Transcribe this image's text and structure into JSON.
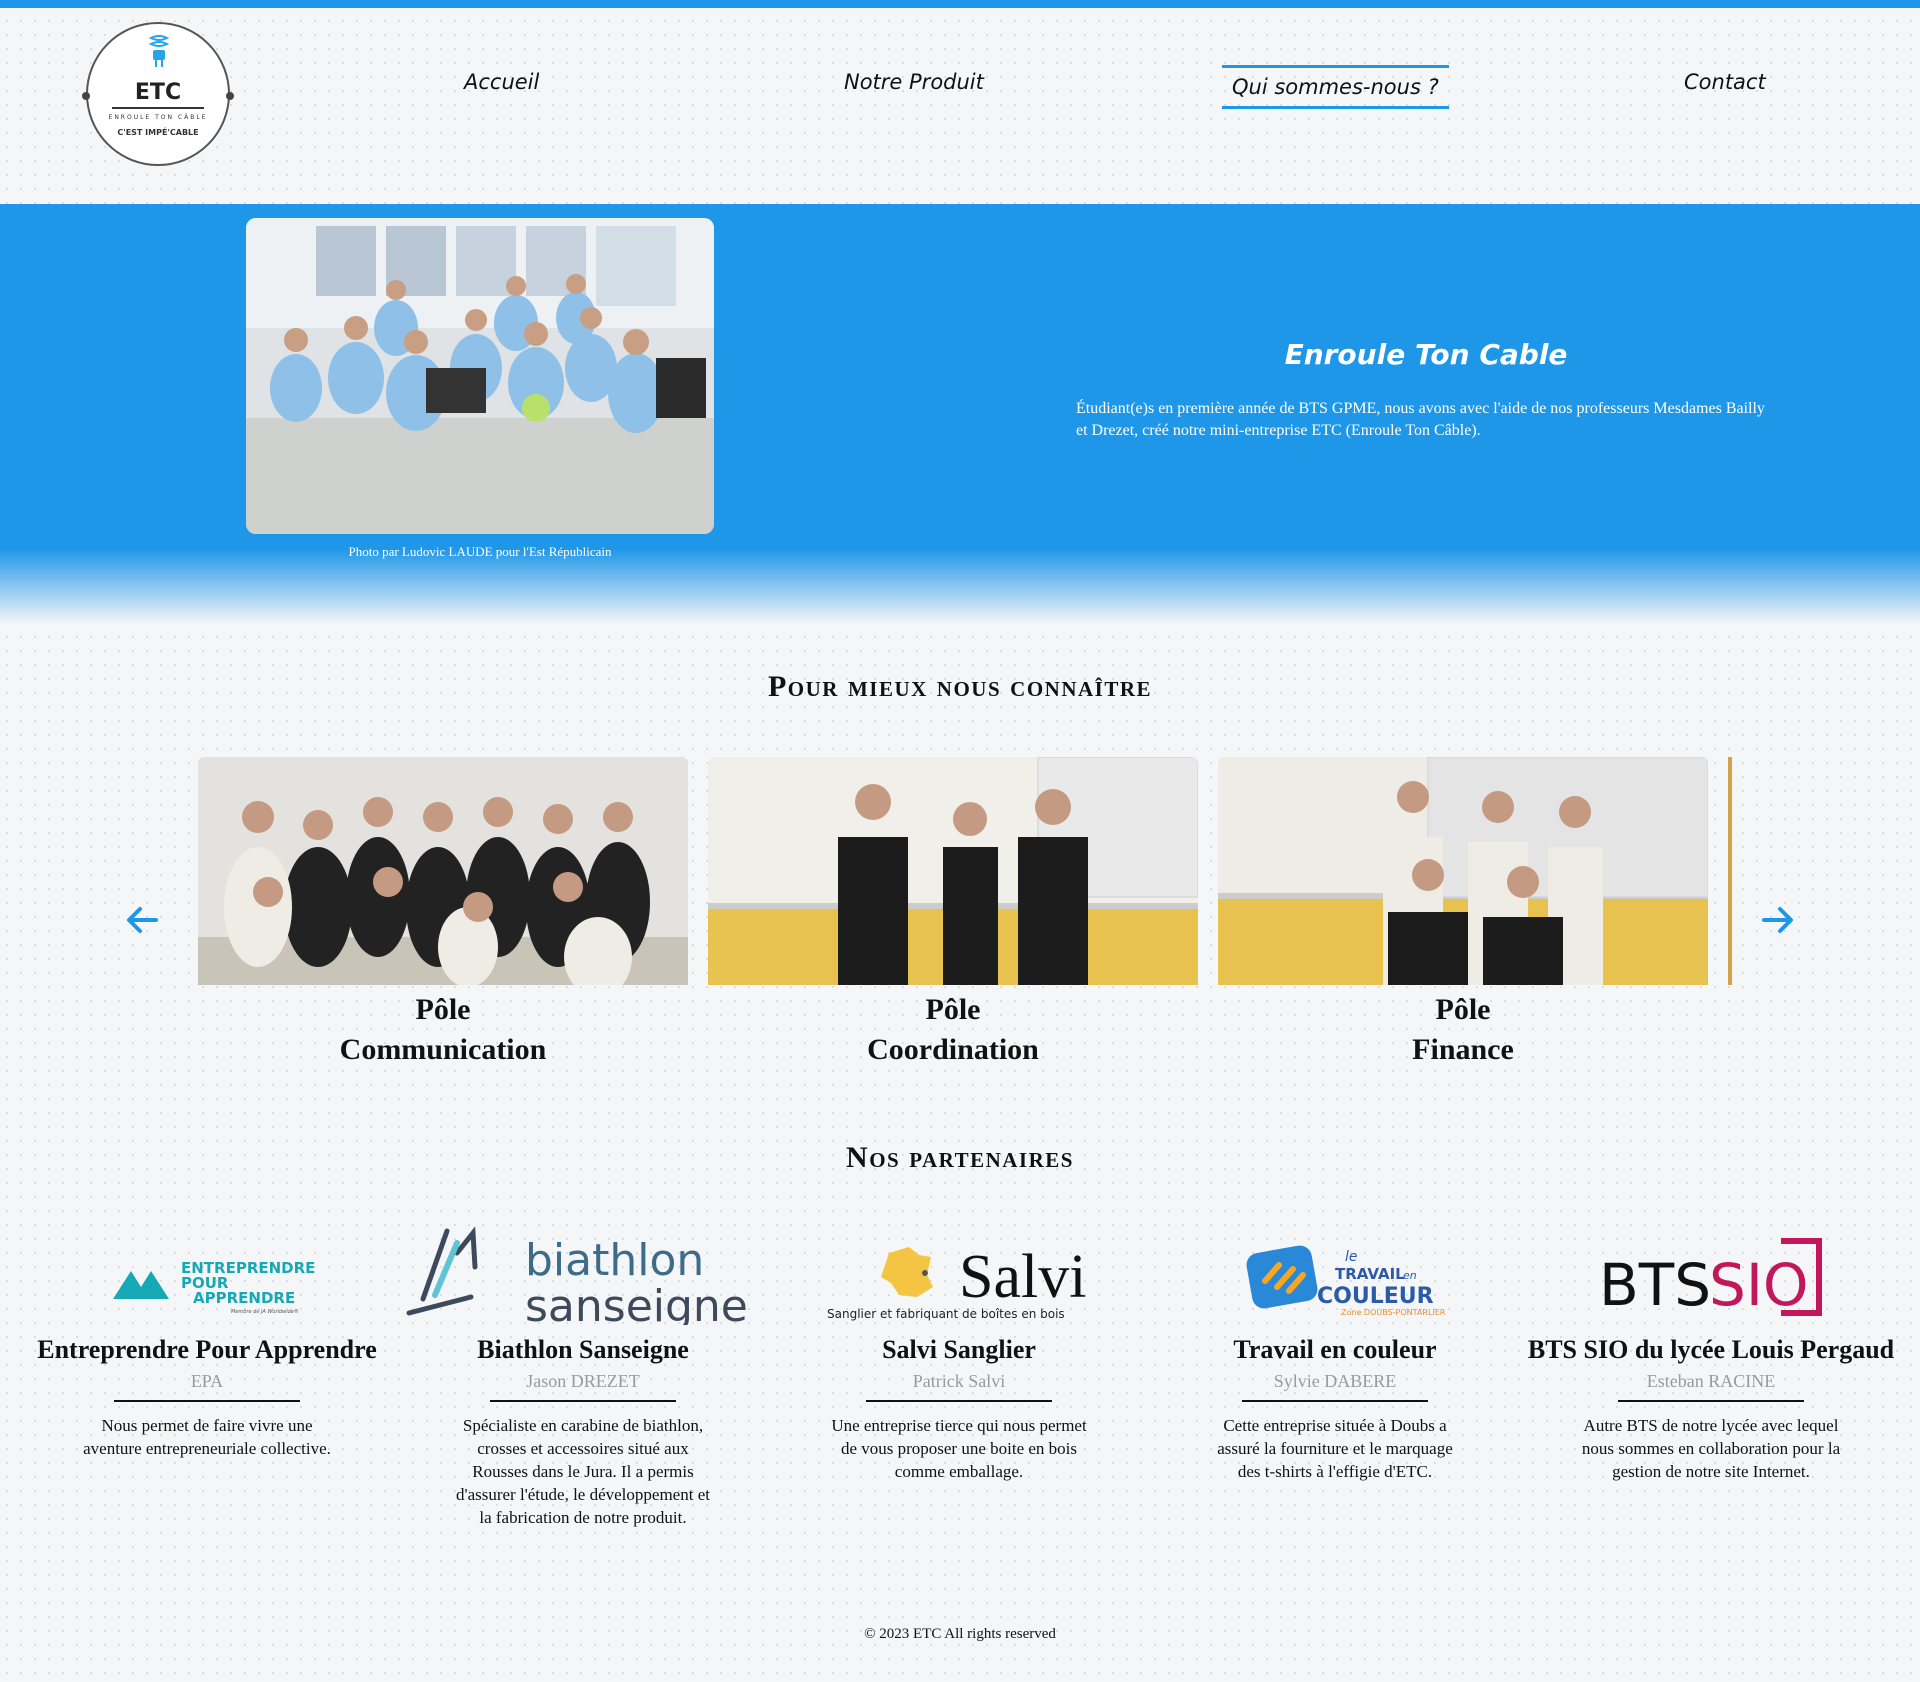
{
  "header": {
    "logo": {
      "name": "ETC",
      "tagline": "ENROULE TON CÂBLE",
      "slogan": "C'EST IMPÉ'CABLE"
    },
    "nav": [
      {
        "label": "Accueil"
      },
      {
        "label": "Notre Produit"
      },
      {
        "label": "Qui sommes-nous ?",
        "active": true
      },
      {
        "label": "Contact"
      }
    ]
  },
  "hero": {
    "photo_caption": "Photo par Ludovic LAUDE pour l'Est Républicain",
    "title": "Enroule Ton Cable",
    "text": "Étudiant(e)s en première année de BTS GPME, nous avons avec l'aide de nos professeurs Mesdames Bailly et Drezet, créé notre mini-entreprise ETC (Enroule Ton Câble)."
  },
  "team": {
    "title": "Pour mieux nous connaître",
    "slides": [
      {
        "line1": "Pôle",
        "line2": "Communication"
      },
      {
        "line1": "Pôle",
        "line2": "Coordination"
      },
      {
        "line1": "Pôle",
        "line2": "Finance"
      }
    ]
  },
  "partners": {
    "title": "Nos partenaires",
    "items": [
      {
        "logo_text": [
          "ENTREPRENDRE",
          "POUR",
          "APPRENDRE",
          "Membre de JA Worldwide®"
        ],
        "name": "Entreprendre Pour Apprendre",
        "contact": "EPA",
        "description": "Nous permet de faire vivre une aventure entrepreneuriale collective."
      },
      {
        "logo_text": [
          "biathlon",
          "sanseigne"
        ],
        "name": "Biathlon Sanseigne",
        "contact": "Jason DREZET",
        "description": "Spécialiste en carabine de biathlon, crosses et accessoires situé aux Rousses dans le Jura. Il a permis d'assurer l'étude, le développement et la fabrication de notre produit."
      },
      {
        "logo_text": [
          "Salvi",
          "Sanglier et fabriquant de boîtes en bois"
        ],
        "name": "Salvi Sanglier",
        "contact": "Patrick Salvi",
        "description": "Une entreprise tierce qui nous permet de vous proposer une boite en bois comme emballage."
      },
      {
        "logo_text": [
          "le",
          "TRAVAIL",
          "en",
          "COULEUR",
          "Zone DOUBS-PONTARLIER"
        ],
        "name": "Travail en couleur",
        "contact": "Sylvie DABERE",
        "description": "Cette entreprise située à Doubs a assuré la fourniture et le marquage des t-shirts à l'effigie d'ETC."
      },
      {
        "logo_text": [
          "BTS",
          "SIO"
        ],
        "name": "BTS SIO du lycée Louis Pergaud",
        "contact": "Esteban RACINE",
        "description": "Autre BTS de notre lycée avec lequel nous sommes en collaboration pour la gestion de notre site Internet."
      }
    ]
  },
  "footer": {
    "text": "© 2023 ETC All rights reserved"
  },
  "colors": {
    "accent": "#1e97e8",
    "text": "#111111",
    "muted": "#9a9a9a",
    "sio_magenta": "#c2185b",
    "epa_teal": "#17a8b5"
  }
}
